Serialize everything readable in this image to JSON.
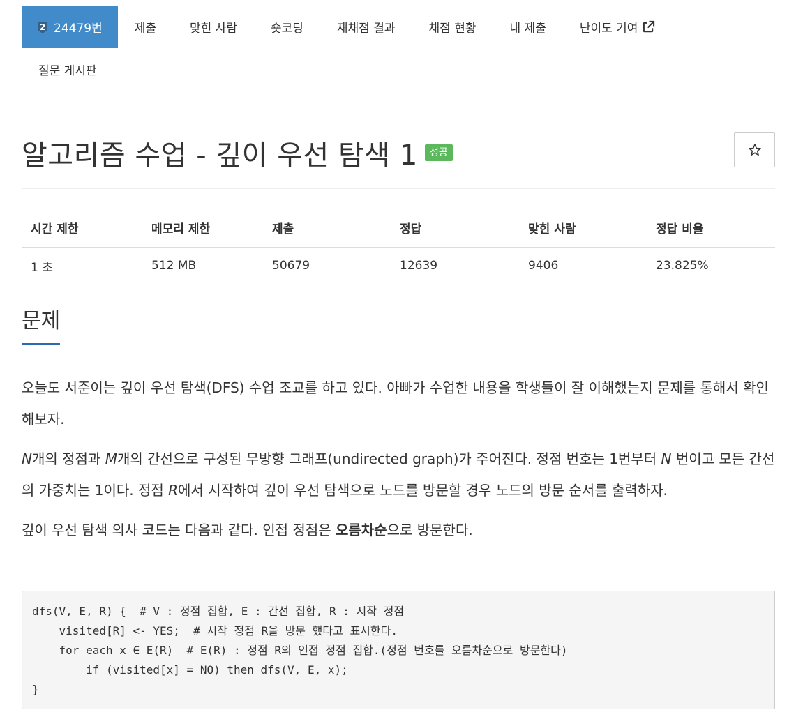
{
  "nav": {
    "items": [
      {
        "label": "24479번",
        "badge": "2",
        "active": true
      },
      {
        "label": "제출"
      },
      {
        "label": "맞힌 사람"
      },
      {
        "label": "숏코딩"
      },
      {
        "label": "재채점 결과"
      },
      {
        "label": "채점 현황"
      },
      {
        "label": "내 제출"
      },
      {
        "label": "난이도 기여",
        "icon": "external-link-icon"
      },
      {
        "label": "질문 게시판"
      }
    ]
  },
  "problem": {
    "title": "알고리즘 수업 - 깊이 우선 탐색 1",
    "result_label": "성공",
    "star_icon": "star-outline-icon"
  },
  "info": {
    "headers": [
      "시간 제한",
      "메모리 제한",
      "제출",
      "정답",
      "맞힌 사람",
      "정답 비율"
    ],
    "values": [
      "1 초",
      "512 MB",
      "50679",
      "12639",
      "9406",
      "23.825%"
    ]
  },
  "section": {
    "title": "문제"
  },
  "body": {
    "p1": "오늘도 서준이는 깊이 우선 탐색(DFS) 수업 조교를 하고 있다. 아빠가 수업한 내용을 학생들이 잘 이해했는지 문제를 통해서 확인해보자.",
    "p2": {
      "var_n": "N",
      "t1": "개의 정점과 ",
      "var_m": "M",
      "t2": "개의 간선으로 구성된 무방향 그래프(undirected graph)가 주어진다. 정점 번호는 1번부터 ",
      "var_n2": "N",
      "t3": " 번이고 모든 간선의 가중치는 1이다. 정점 ",
      "var_r": "R",
      "t4": "에서 시작하여 깊이 우선 탐색으로 노드를 방문할 경우 노드의 방문 순서를 출력하자."
    },
    "p3": {
      "t1": "깊이 우선 탐색 의사 코드는 다음과 같다. 인접 정점은 ",
      "bold": "오름차순",
      "t2": "으로 방문한다."
    },
    "code": "dfs(V, E, R) {  # V : 정점 집합, E : 간선 집합, R : 시작 정점\n    visited[R] <- YES;  # 시작 정점 R을 방문 했다고 표시한다.\n    for each x ∈ E(R)  # E(R) : 정점 R의 인접 정점 집합.(정점 번호를 오름차순으로 방문한다)\n        if (visited[x] = NO) then dfs(V, E, x);\n}"
  },
  "colors": {
    "nav_active": "#428bca",
    "success_label": "#5cb85c",
    "section_underline": "#2b6cb0"
  }
}
